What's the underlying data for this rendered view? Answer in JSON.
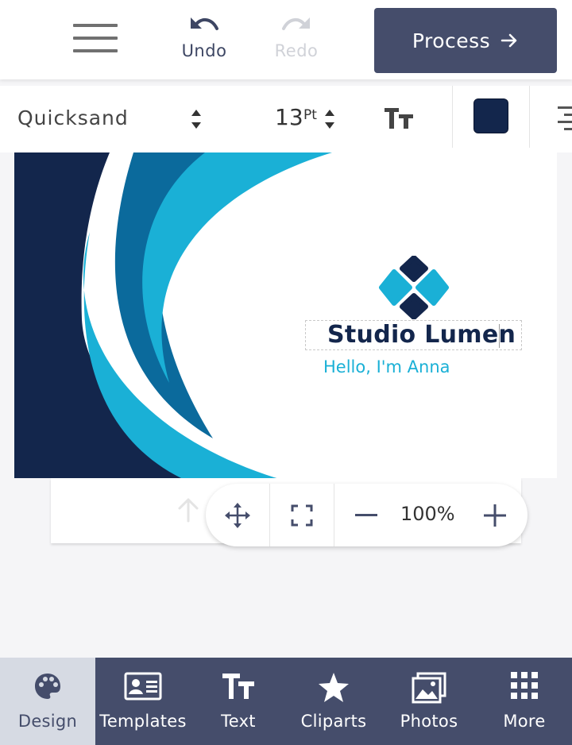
{
  "topbar": {
    "undo_label": "Undo",
    "redo_label": "Redo",
    "process_label": "Process"
  },
  "format_toolbar": {
    "font_name": "Quicksand",
    "font_size": "13",
    "font_size_unit": "Pt",
    "text_color": "#13264c"
  },
  "canvas": {
    "title_text": "Studio Lumen",
    "subtitle_text": "Hello, I'm Anna",
    "colors": {
      "navy": "#13264c",
      "cyan": "#1ab0d6",
      "blue": "#0b6a9c"
    }
  },
  "zoom": {
    "value": "100%"
  },
  "bottom_nav": {
    "items": [
      {
        "label": "Design",
        "icon": "palette-icon",
        "active": true
      },
      {
        "label": "Templates",
        "icon": "id-card-icon",
        "active": false
      },
      {
        "label": "Text",
        "icon": "text-size-icon",
        "active": false
      },
      {
        "label": "Cliparts",
        "icon": "star-icon",
        "active": false
      },
      {
        "label": "Photos",
        "icon": "photos-icon",
        "active": false
      },
      {
        "label": "More",
        "icon": "grid-icon",
        "active": false
      }
    ]
  },
  "theme": {
    "primary": "#454d6b",
    "active_tab_bg": "#d6dae3"
  }
}
